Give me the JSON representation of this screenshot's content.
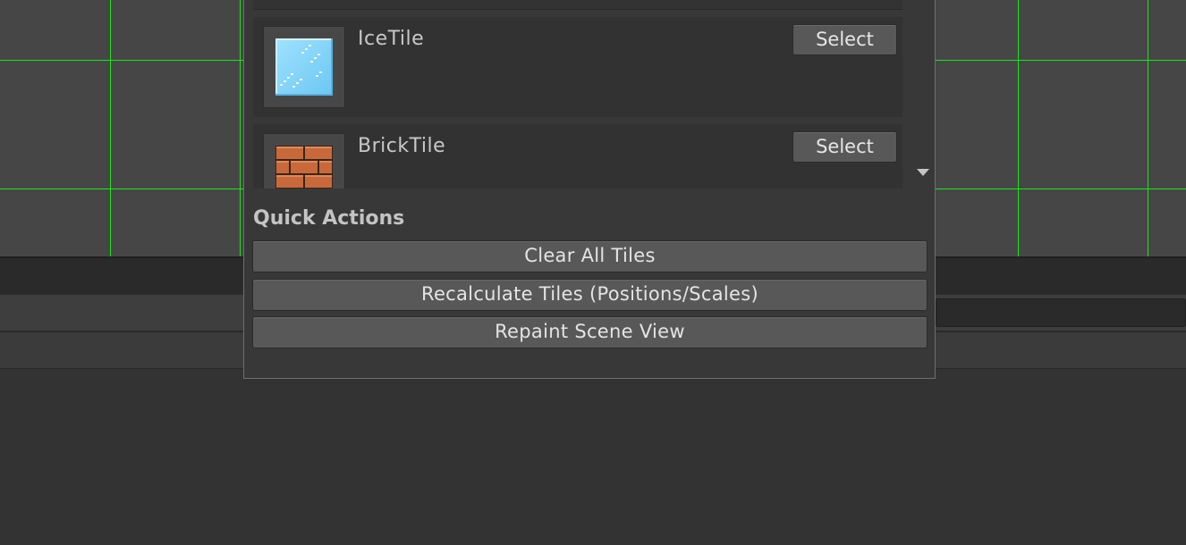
{
  "background": {
    "scene_grid_color": "#17e817"
  },
  "tile_palette": {
    "items": [
      {
        "name": "IceTile",
        "select_label": "Select",
        "preview_icon": "ice-tile-icon"
      },
      {
        "name": "BrickTile",
        "select_label": "Select",
        "preview_icon": "brick-tile-icon"
      }
    ],
    "scroll_icon": "scroll-down-arrow-icon"
  },
  "quick_actions": {
    "title": "Quick Actions",
    "buttons": [
      {
        "label": "Clear All Tiles"
      },
      {
        "label": "Recalculate Tiles (Positions/Scales)"
      },
      {
        "label": "Repaint Scene View"
      }
    ]
  }
}
